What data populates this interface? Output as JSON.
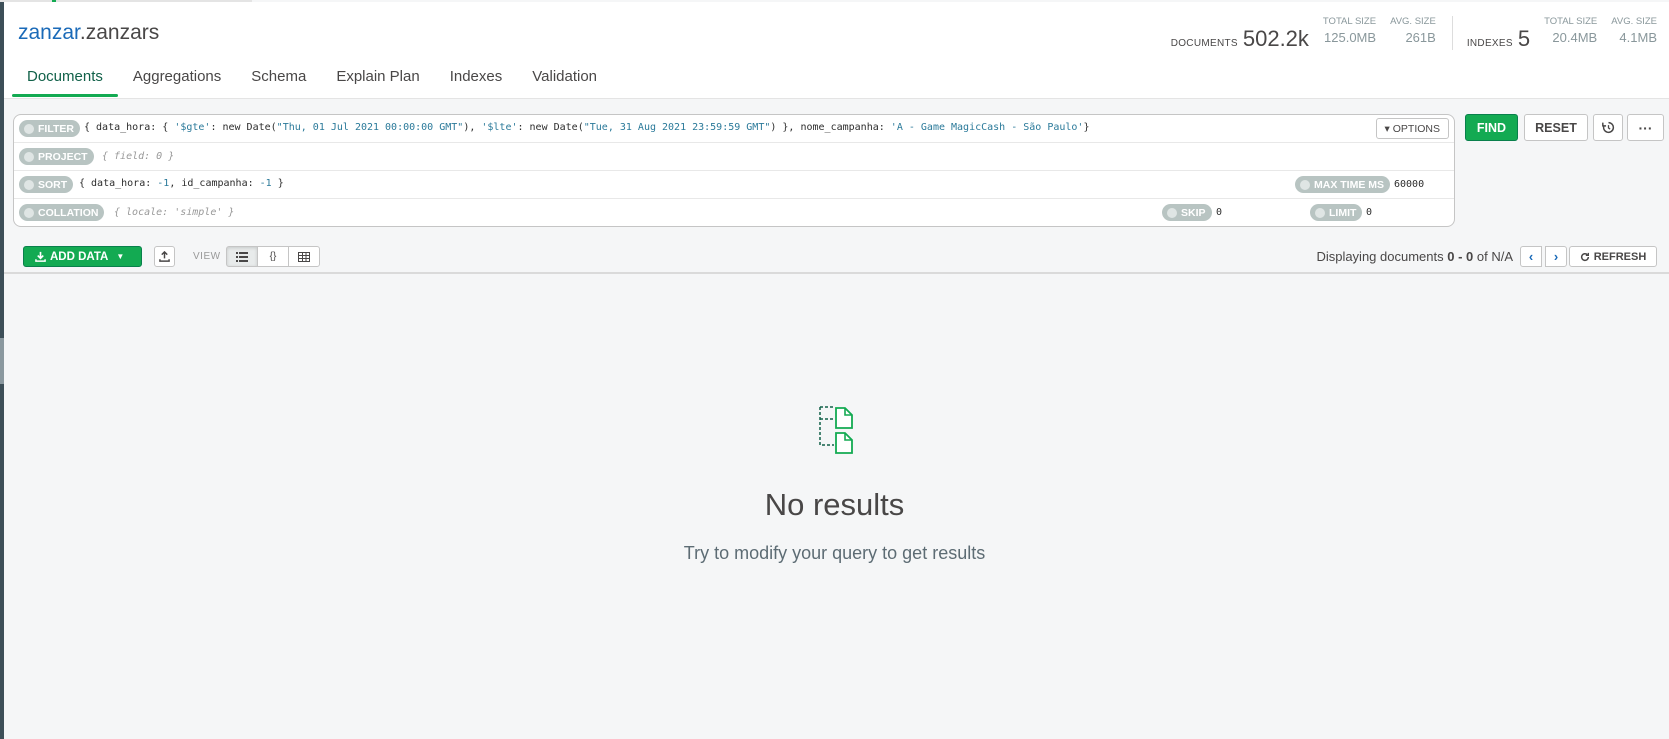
{
  "namespace": {
    "db": "zanzar",
    "dot": ".",
    "collection": "zanzars"
  },
  "stats": {
    "documents_label": "DOCUMENTS",
    "documents_value": "502.2k",
    "total_size_label": "TOTAL SIZE",
    "total_size_value": "125.0MB",
    "avg_size_label": "AVG. SIZE",
    "avg_size_value": "261B",
    "indexes_label": "INDEXES",
    "indexes_value": "5",
    "idx_total_size_label": "TOTAL SIZE",
    "idx_total_size_value": "20.4MB",
    "idx_avg_size_label": "AVG. SIZE",
    "idx_avg_size_value": "4.1MB"
  },
  "tabs": [
    {
      "label": "Documents"
    },
    {
      "label": "Aggregations"
    },
    {
      "label": "Schema"
    },
    {
      "label": "Explain Plan"
    },
    {
      "label": "Indexes"
    },
    {
      "label": "Validation"
    }
  ],
  "query": {
    "filter_label": "FILTER",
    "filter_parts": {
      "p1": "{ data_hora: { ",
      "s1": "'$gte'",
      "p2": ": new Date(",
      "s2": "\"Thu, 01 Jul 2021 00:00:00 GMT\"",
      "p3": "), ",
      "s3": "'$lte'",
      "p4": ": new Date(",
      "s4": "\"Tue, 31 Aug 2021 23:59:59 GMT\"",
      "p5": ") }, nome_campanha: ",
      "s5": "'A - Game MagicCash - São Paulo'",
      "p6": "}"
    },
    "options_label": "▾ OPTIONS",
    "project_label": "PROJECT",
    "project_placeholder": "{ field: 0 }",
    "sort_label": "SORT",
    "sort_parts": {
      "p1": "{ data_hora: ",
      "n1": "-1",
      "p2": ", id_campanha: ",
      "n2": "-1",
      "p3": " }"
    },
    "max_time_label": "MAX TIME MS",
    "max_time_value": "60000",
    "collation_label": "COLLATION",
    "collation_placeholder": "{ locale: 'simple' }",
    "skip_label": "SKIP",
    "skip_value": "0",
    "limit_label": "LIMIT",
    "limit_value": "0"
  },
  "buttons": {
    "find": "FIND",
    "reset": "RESET",
    "history_icon": "history-icon",
    "more": "···"
  },
  "toolbar": {
    "add_data": "ADD DATA",
    "view_label": "VIEW",
    "display_prefix": "Displaying documents ",
    "display_range": "0 - 0",
    "display_suffix": " of N/A",
    "refresh": "REFRESH"
  },
  "empty": {
    "title": "No results",
    "hint": "Try to modify your query to get results"
  },
  "colors": {
    "accent": "#13aa52",
    "link": "#1a6ab8"
  }
}
